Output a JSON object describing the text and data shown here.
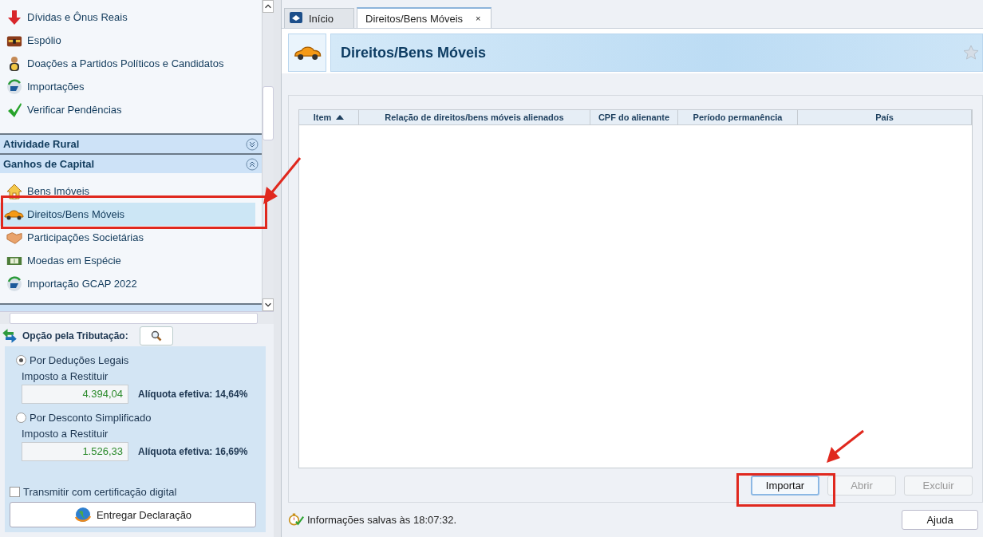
{
  "sidebar": {
    "items": [
      {
        "label": "Dívidas e Ônus Reais",
        "kind": "debt",
        "selected": false
      },
      {
        "label": "Espólio",
        "kind": "chest",
        "selected": false
      },
      {
        "label": "Doações a Partidos Políticos e Candidatos",
        "kind": "donation",
        "selected": false
      },
      {
        "label": "Importações",
        "kind": "import",
        "selected": false
      },
      {
        "label": "Verificar Pendências",
        "kind": "check",
        "selected": false
      }
    ],
    "sections": [
      {
        "title": "Atividade Rural",
        "expanded": false
      },
      {
        "title": "Ganhos de Capital",
        "expanded": true,
        "items": [
          {
            "label": "Bens Imóveis",
            "kind": "house",
            "selected": false
          },
          {
            "label": "Direitos/Bens Móveis",
            "kind": "car",
            "selected": true
          },
          {
            "label": "Participações Societárias",
            "kind": "handshake",
            "selected": false
          },
          {
            "label": "Moedas em Espécie",
            "kind": "money",
            "selected": false
          },
          {
            "label": "Importação GCAP 2022",
            "kind": "import",
            "selected": false
          }
        ]
      }
    ]
  },
  "taxation": {
    "title": "Opção pela Tributação:",
    "options": [
      {
        "label": "Por Deduções Legais",
        "selected": true,
        "amount_label": "Imposto a Restituir",
        "amount": "4.394,04",
        "rate": "Alíquota efetiva: 14,64%"
      },
      {
        "label": "Por Desconto Simplificado",
        "selected": false,
        "amount_label": "Imposto a Restituir",
        "amount": "1.526,33",
        "rate": "Alíquota efetiva: 16,69%"
      }
    ],
    "certificate": {
      "label": "Transmitir com certificação digital",
      "checked": false
    },
    "submit": "Entregar Declaração"
  },
  "tabs": [
    {
      "label": "Início",
      "selected": false
    },
    {
      "label": "Direitos/Bens Móveis",
      "selected": true,
      "close": "×"
    }
  ],
  "page": {
    "title": "Direitos/Bens Móveis"
  },
  "table": {
    "columns": [
      {
        "label": "Item",
        "sorted": true
      },
      {
        "label": "Relação de direitos/bens móveis alienados",
        "sorted": false
      },
      {
        "label": "CPF do alienante",
        "sorted": false
      },
      {
        "label": "Período permanência",
        "sorted": false
      },
      {
        "label": "País",
        "sorted": false
      }
    ]
  },
  "buttons": [
    {
      "label": "Importar",
      "disabled": false
    },
    {
      "label": "Abrir",
      "disabled": true
    },
    {
      "label": "Excluir",
      "disabled": true
    }
  ],
  "status_bar": {
    "text": "Informações salvas às 18:07:32.",
    "help": "Ajuda"
  }
}
